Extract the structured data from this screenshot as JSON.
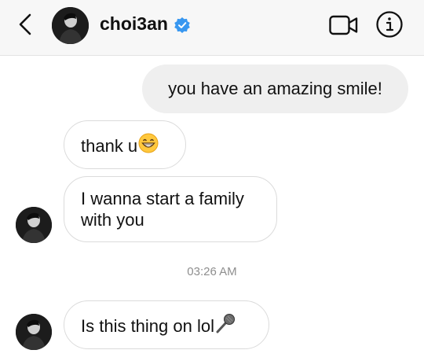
{
  "header": {
    "username": "choi3an",
    "verified": true,
    "icons": [
      "back-chevron-icon",
      "verified-badge-icon",
      "video-camera-icon",
      "info-icon"
    ],
    "accent_color": "#3897f0"
  },
  "messages": [
    {
      "direction": "outgoing",
      "text": "you have an amazing smile!"
    },
    {
      "direction": "incoming",
      "text": "thank u",
      "emoji": "grinning-face-icon"
    },
    {
      "direction": "incoming",
      "lines": [
        "I wanna start a family",
        "with you"
      ]
    },
    {
      "direction": "incoming",
      "text": "Is this thing on lol",
      "emoji": "microphone-icon"
    }
  ],
  "timestamp": "03:26 AM",
  "colors": {
    "header_bg": "#f7f7f7",
    "outgoing_bubble": "#efefef",
    "incoming_border": "#dbdbdb",
    "timestamp_text": "#8e8e8e"
  }
}
